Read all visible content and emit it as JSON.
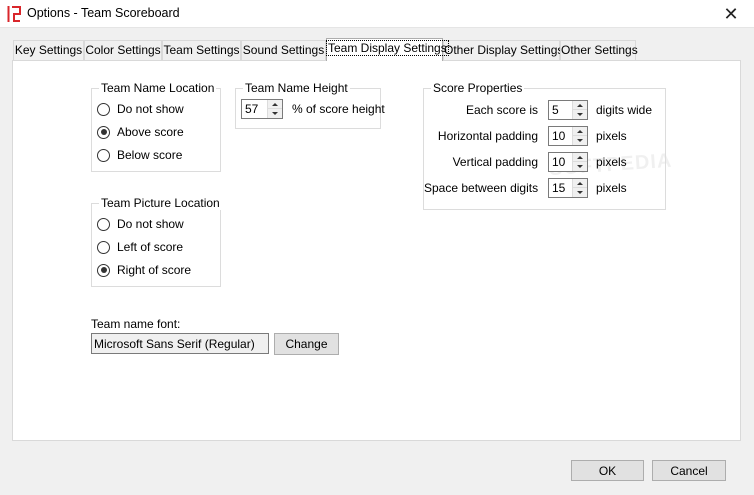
{
  "window": {
    "title": "Options - Team Scoreboard",
    "close_glyph": "✕"
  },
  "tabs": [
    {
      "label": "Key Settings",
      "active": false
    },
    {
      "label": "Color Settings",
      "active": false
    },
    {
      "label": "Team Settings",
      "active": false
    },
    {
      "label": "Sound Settings",
      "active": false
    },
    {
      "label": "Team Display Settings",
      "active": true
    },
    {
      "label": "Other Display Settings",
      "active": false
    },
    {
      "label": "Other Settings",
      "active": false
    }
  ],
  "team_name_location": {
    "title": "Team Name Location",
    "options": [
      {
        "label": "Do not show",
        "checked": false
      },
      {
        "label": "Above score",
        "checked": true
      },
      {
        "label": "Below score",
        "checked": false
      }
    ]
  },
  "team_picture_location": {
    "title": "Team Picture Location",
    "options": [
      {
        "label": "Do not show",
        "checked": false
      },
      {
        "label": "Left of score",
        "checked": false
      },
      {
        "label": "Right of score",
        "checked": true
      }
    ]
  },
  "team_name_height": {
    "title": "Team Name Height",
    "value": "57",
    "unit": "% of score height"
  },
  "score_properties": {
    "title": "Score Properties",
    "each_score": {
      "label": "Each score is",
      "value": "5",
      "unit": "digits wide"
    },
    "horizontal_padding": {
      "label": "Horizontal padding",
      "value": "10",
      "unit": "pixels"
    },
    "vertical_padding": {
      "label": "Vertical padding",
      "value": "10",
      "unit": "pixels"
    },
    "digit_spacing": {
      "label": "Space between digits",
      "value": "15",
      "unit": "pixels"
    }
  },
  "team_name_font": {
    "label": "Team name font:",
    "value": "Microsoft Sans Serif (Regular)",
    "change_label": "Change"
  },
  "footer": {
    "ok_label": "OK",
    "cancel_label": "Cancel"
  },
  "colors": {
    "active_tab_border": "#adadad",
    "button_face": "#e1e1e1",
    "app_icon_red": "#d9262b"
  }
}
